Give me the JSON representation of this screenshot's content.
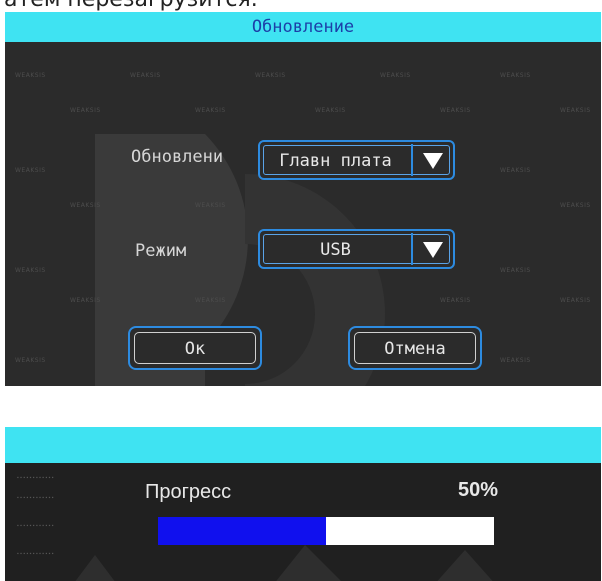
{
  "caption": "атем перезагрузится.",
  "dialog": {
    "title": "Обновление",
    "watermark": "WEAKSIS",
    "fields": {
      "update_label": "Обновлени",
      "update_value": "Главн плата",
      "mode_label": "Режим",
      "mode_value": "USB"
    },
    "buttons": {
      "ok": "Ок",
      "cancel": "Отмена"
    }
  },
  "progress": {
    "label": "Прогресс",
    "percent_text": "50%",
    "value": 0.5
  },
  "colors": {
    "title_bar": "#3fe3f2",
    "accent_border": "#2d8be0",
    "progress_fill": "#1010ee",
    "panel_bg": "#2b2b2b"
  }
}
